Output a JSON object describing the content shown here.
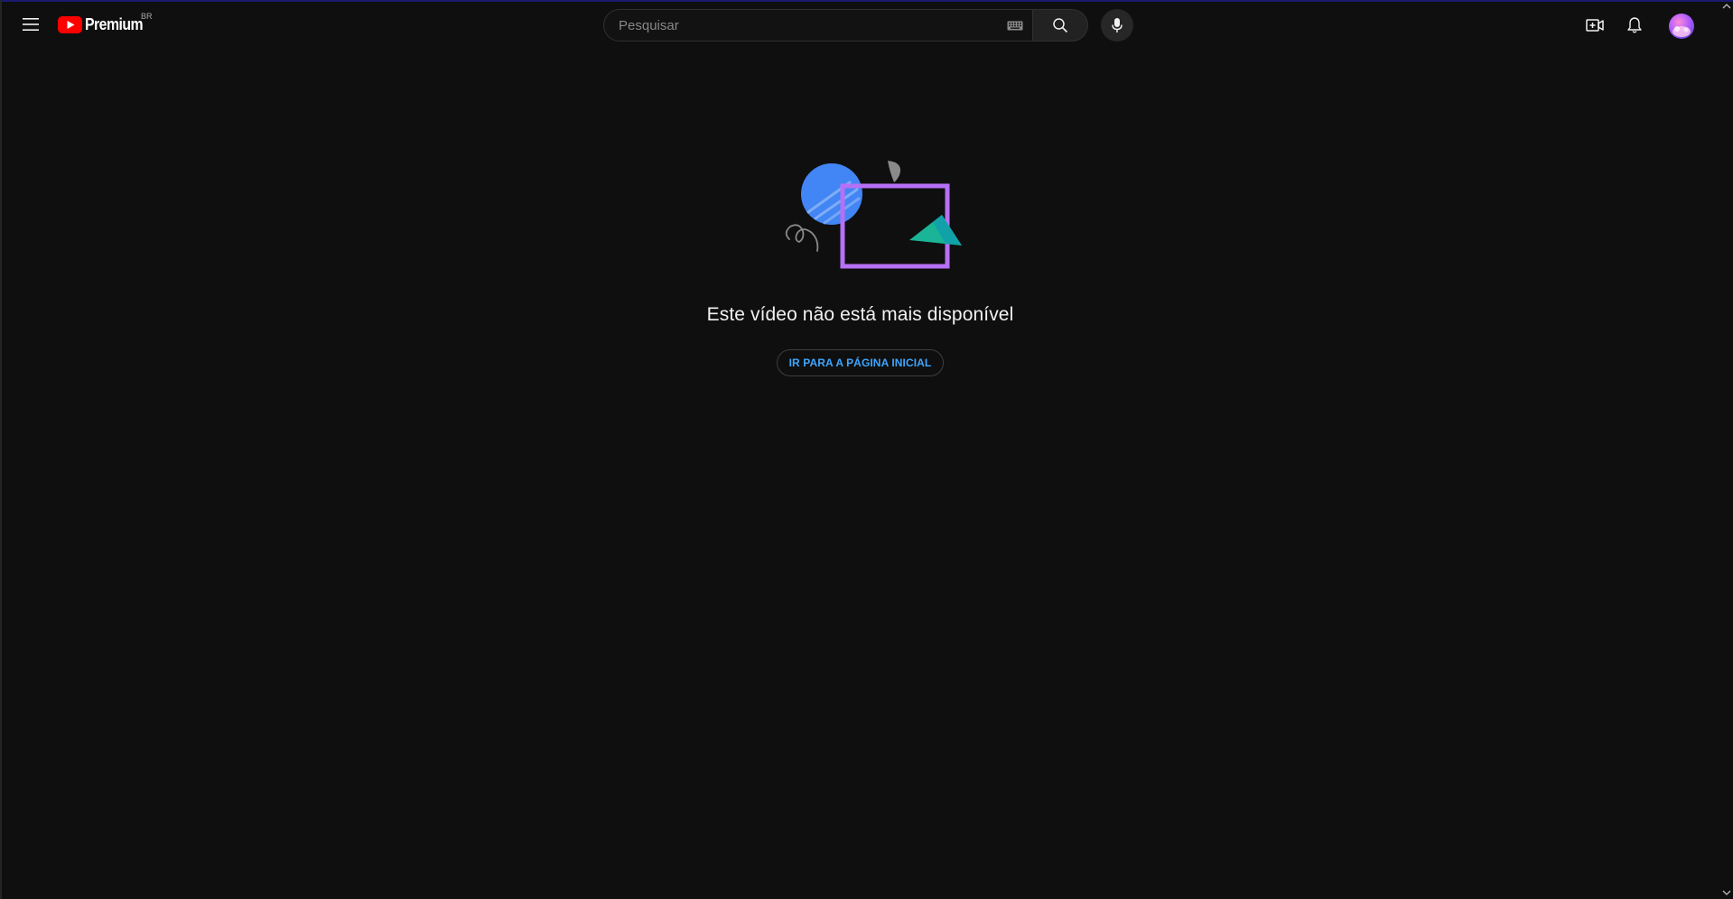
{
  "app": {
    "logo_text": "Premium",
    "logo_country": "BR"
  },
  "search": {
    "placeholder": "Pesquisar",
    "value": ""
  },
  "icons": {
    "menu": "hamburger-menu-icon",
    "logo": "youtube-play-logo-icon",
    "keyboard": "keyboard-icon",
    "search": "search-icon",
    "mic": "microphone-icon",
    "create": "create-video-icon",
    "notifications": "bell-icon",
    "avatar": "user-avatar"
  },
  "content": {
    "error_message": "Este vídeo não está mais disponível",
    "home_button_label": "IR PARA A PÁGINA INICIAL"
  },
  "colors": {
    "background": "#0f0f0f",
    "brand_red": "#ff0000",
    "link_blue": "#3ea6ff",
    "illustration_purple": "#b670f5",
    "illustration_blue": "#4285f4",
    "illustration_teal": "#1ab497"
  }
}
